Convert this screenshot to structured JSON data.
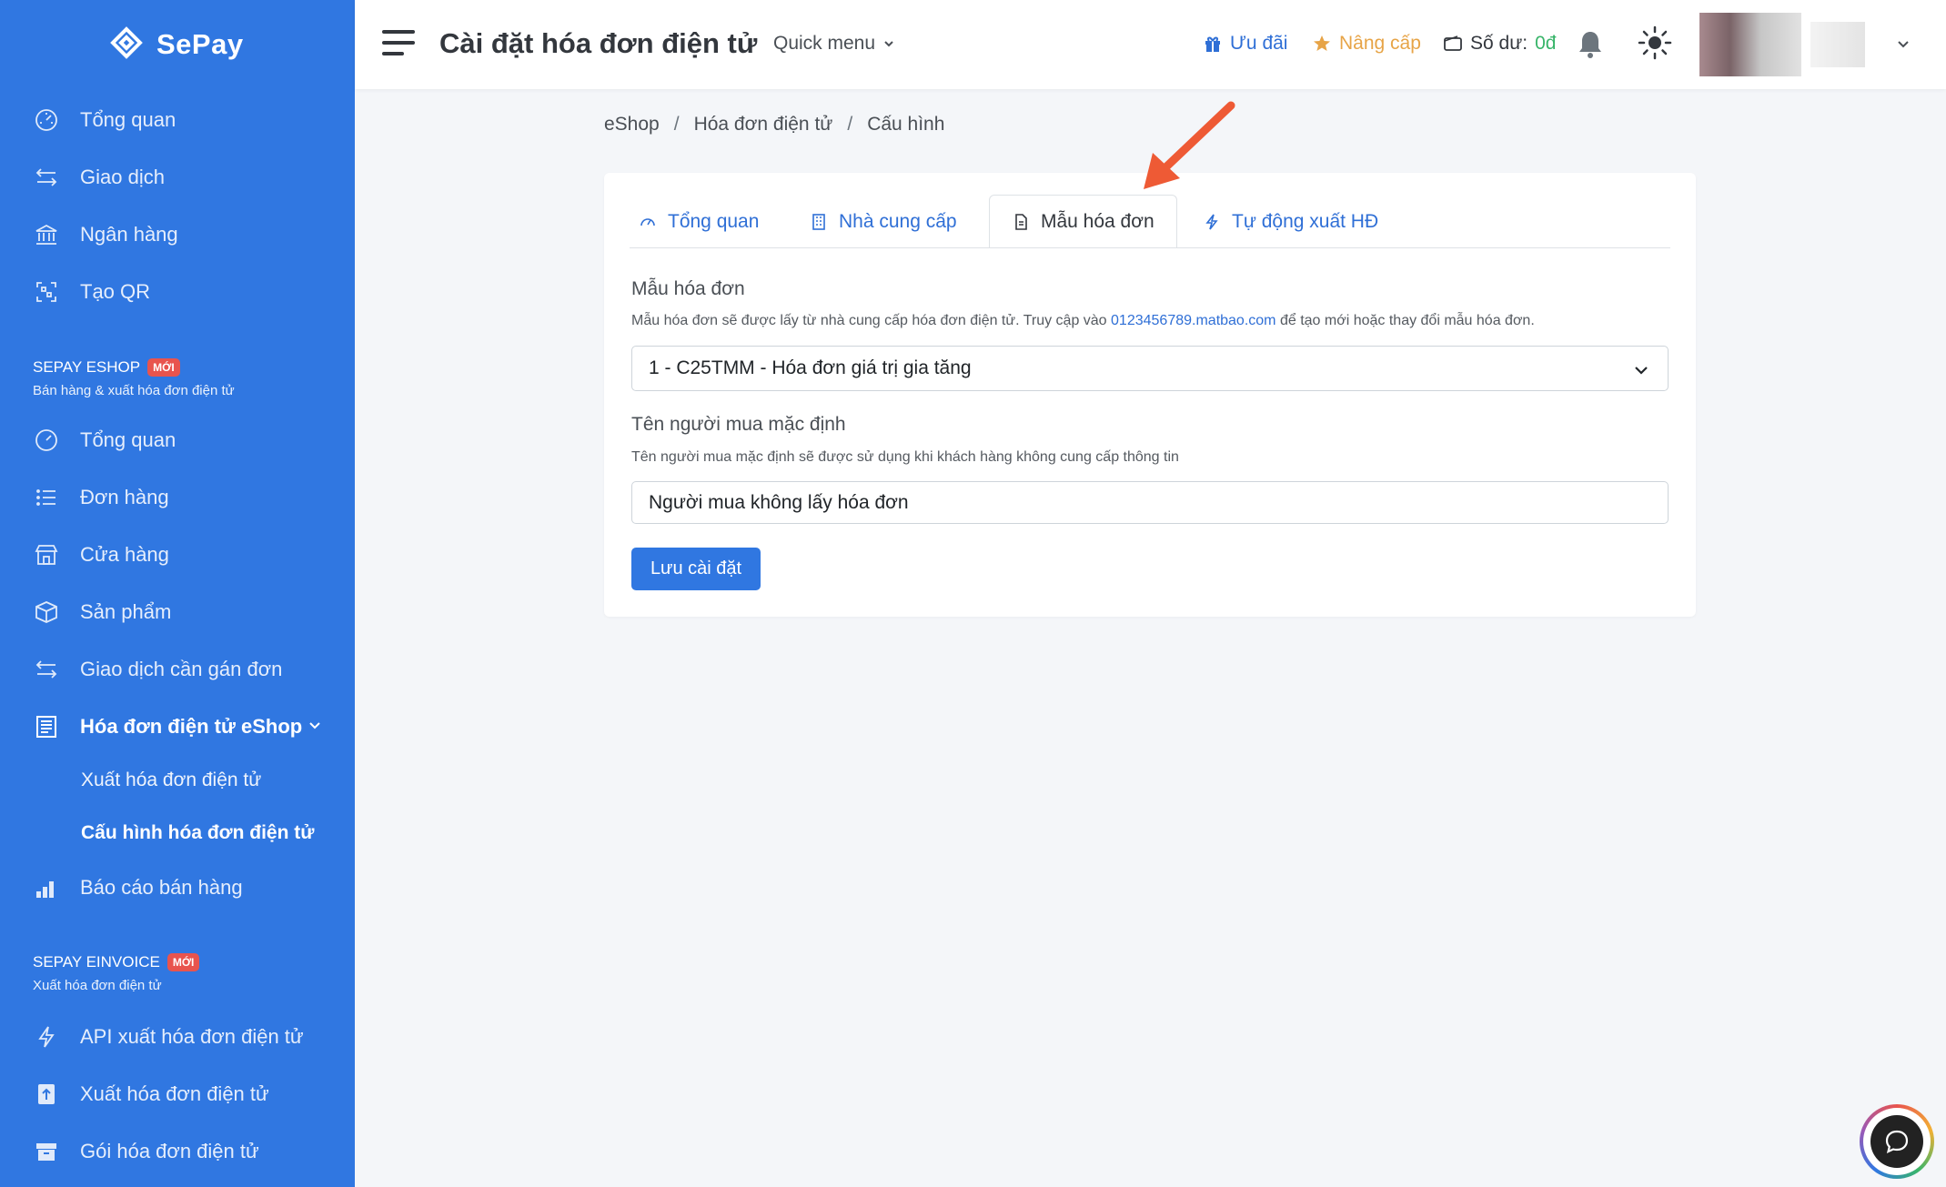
{
  "brand": {
    "name": "SePay"
  },
  "sidebar": {
    "main_items": [
      {
        "label": "Tổng quan",
        "icon": "gauge-icon"
      },
      {
        "label": "Giao dịch",
        "icon": "exchange-icon"
      },
      {
        "label": "Ngân hàng",
        "icon": "bank-icon"
      },
      {
        "label": "Tạo QR",
        "icon": "qr-icon"
      }
    ],
    "eshop_section": {
      "title": "SEPAY ESHOP",
      "badge": "MỚI",
      "subtitle": "Bán hàng & xuất hóa đơn điện tử"
    },
    "eshop_items": [
      {
        "label": "Tổng quan",
        "icon": "gauge-icon"
      },
      {
        "label": "Đơn hàng",
        "icon": "list-icon"
      },
      {
        "label": "Cửa hàng",
        "icon": "store-icon"
      },
      {
        "label": "Sản phẩm",
        "icon": "box-icon"
      },
      {
        "label": "Giao dịch cần gán đơn",
        "icon": "exchange-icon"
      },
      {
        "label": "Hóa đơn điện tử eShop",
        "icon": "invoice-icon"
      }
    ],
    "eshop_sub_items": [
      {
        "label": "Xuất hóa đơn điện tử"
      },
      {
        "label": "Cấu hình hóa đơn điện tử"
      }
    ],
    "report_item": {
      "label": "Báo cáo bán hàng",
      "icon": "bar-chart-icon"
    },
    "einvoice_section": {
      "title": "SEPAY EINVOICE",
      "badge": "MỚI",
      "subtitle": "Xuất hóa đơn điện tử"
    },
    "einvoice_items": [
      {
        "label": "API xuất hóa đơn điện tử",
        "icon": "bolt-icon"
      },
      {
        "label": "Xuất hóa đơn điện tử",
        "icon": "upload-icon"
      },
      {
        "label": "Gói hóa đơn điện tử",
        "icon": "archive-icon"
      }
    ]
  },
  "header": {
    "title": "Cài đặt hóa đơn điện tử",
    "quick_menu": "Quick menu",
    "promo": "Ưu đãi",
    "upgrade": "Nâng cấp",
    "balance_label": "Số dư:",
    "balance_value": "0đ"
  },
  "breadcrumb": [
    "eShop",
    "Hóa đơn điện tử",
    "Cấu hình"
  ],
  "tabs": [
    {
      "label": "Tổng quan",
      "icon": "gauge-icon"
    },
    {
      "label": "Nhà cung cấp",
      "icon": "building-icon"
    },
    {
      "label": "Mẫu hóa đơn",
      "icon": "file-icon"
    },
    {
      "label": "Tự động xuất HĐ",
      "icon": "bolt-icon"
    }
  ],
  "form": {
    "template_label": "Mẫu hóa đơn",
    "template_help_prefix": "Mẫu hóa đơn sẽ được lấy từ nhà cung cấp hóa đơn điện tử. Truy cập vào",
    "template_help_link": "0123456789.matbao.com",
    "template_help_suffix": "để tạo mới hoặc thay đổi mẫu hóa đơn.",
    "template_value": "1 - C25TMM - Hóa đơn giá trị gia tăng",
    "buyer_label": "Tên người mua mặc định",
    "buyer_help": "Tên người mua mặc định sẽ được sử dụng khi khách hàng không cung cấp thông tin",
    "buyer_value": "Người mua không lấy hóa đơn",
    "save_label": "Lưu cài đặt"
  },
  "colors": {
    "primary": "#3077e1",
    "accent_arrow": "#ee5a35",
    "upgrade": "#e7a447",
    "balance": "#39b56a",
    "badge": "#e8544e"
  }
}
